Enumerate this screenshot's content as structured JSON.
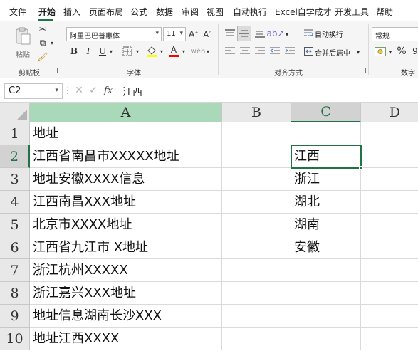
{
  "menu": {
    "items": [
      "文件",
      "开始",
      "插入",
      "页面布局",
      "公式",
      "数据",
      "审阅",
      "视图",
      "自动执行",
      "Excel自学成才",
      "开发工具",
      "帮助"
    ],
    "active": "开始"
  },
  "ribbon": {
    "clipboard": {
      "label": "剪贴板",
      "paste_label": "粘贴"
    },
    "font": {
      "label": "字体",
      "name": "阿里巴巴普惠体",
      "size": "11",
      "bold": "B",
      "italic": "I",
      "underline": "U"
    },
    "alignment": {
      "label": "对齐方式",
      "wrap_text": "自动换行",
      "merge_center": "合并后居中"
    },
    "number": {
      "label": "数字",
      "format": "常规",
      "percent": "%"
    },
    "colors": {
      "accent": "#217346",
      "highlight_fill": "#ffff00",
      "font_color": "#ff0000"
    }
  },
  "formula_bar": {
    "cell_ref": "C2",
    "fx": "fx",
    "value": "江西"
  },
  "sheet": {
    "columns": [
      "A",
      "B",
      "C",
      "D"
    ],
    "selected_column": "C",
    "selected_row": "2",
    "rows": [
      {
        "num": "1",
        "a": "地址",
        "c": ""
      },
      {
        "num": "2",
        "a": "江西省南昌市XXXXX地址",
        "c": "江西"
      },
      {
        "num": "3",
        "a": "地址安徽XXXX信息",
        "c": "浙江"
      },
      {
        "num": "4",
        "a": "江西南昌XXX地址",
        "c": "湖北"
      },
      {
        "num": "5",
        "a": "北京市XXXX地址",
        "c": "湖南"
      },
      {
        "num": "6",
        "a": "江西省九江市 X地址",
        "c": "安徽"
      },
      {
        "num": "7",
        "a": "浙江杭州XXXXX",
        "c": ""
      },
      {
        "num": "8",
        "a": "浙江嘉兴XXX地址",
        "c": ""
      },
      {
        "num": "9",
        "a": "地址信息湖南长沙XXX",
        "c": ""
      },
      {
        "num": "10",
        "a": "地址江西XXXX",
        "c": ""
      }
    ]
  }
}
